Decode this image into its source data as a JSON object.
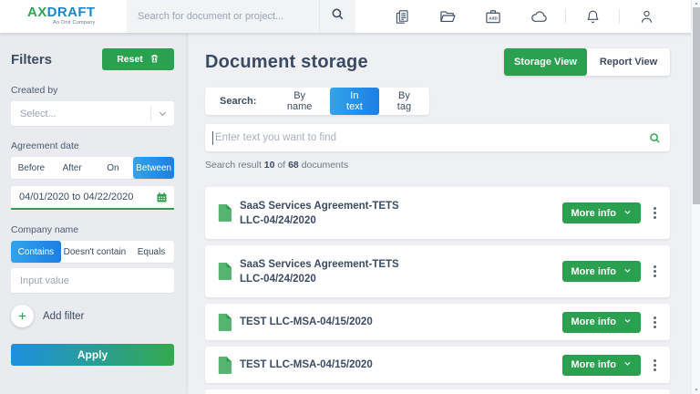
{
  "header": {
    "logo": {
      "part1": "AX",
      "part2": "DRAFT",
      "subtitle": "An Onit Company"
    },
    "search_placeholder": "Search for document or project...",
    "briefcase_label": "AXD"
  },
  "sidebar": {
    "title": "Filters",
    "reset_label": "Reset",
    "created_by": {
      "label": "Created by",
      "value": "Select..."
    },
    "agreement_date": {
      "label": "Agreement date",
      "options": [
        "Before",
        "After",
        "On",
        "Between"
      ],
      "selected": "Between",
      "value": "04/01/2020 to 04/22/2020"
    },
    "company_name": {
      "label": "Company name",
      "options": [
        "Contains",
        "Doesn't contain",
        "Equals"
      ],
      "selected": "Contains",
      "placeholder": "Input value"
    },
    "add_filter_label": "Add filter",
    "apply_label": "Apply"
  },
  "main": {
    "title": "Document storage",
    "views": {
      "storage": "Storage View",
      "report": "Report View",
      "selected": "Storage View"
    },
    "search_tabs": {
      "label": "Search:",
      "options": [
        "By name",
        "In text",
        "By tag"
      ],
      "selected": "In text"
    },
    "find_placeholder": "Enter text you want to find",
    "result": {
      "prefix": "Search result",
      "shown": "10",
      "of": "of",
      "total": "68",
      "suffix": "documents"
    },
    "more_info_label": "More info",
    "documents": [
      {
        "line1": "SaaS Services Agreement-TETS",
        "line2": "LLC-04/24/2020"
      },
      {
        "line1": "SaaS Services Agreement-TETS",
        "line2": "LLC-04/24/2020"
      },
      {
        "line1": "TEST LLC-MSA-04/15/2020",
        "line2": ""
      },
      {
        "line1": "TEST LLC-MSA-04/15/2020",
        "line2": ""
      }
    ]
  }
}
